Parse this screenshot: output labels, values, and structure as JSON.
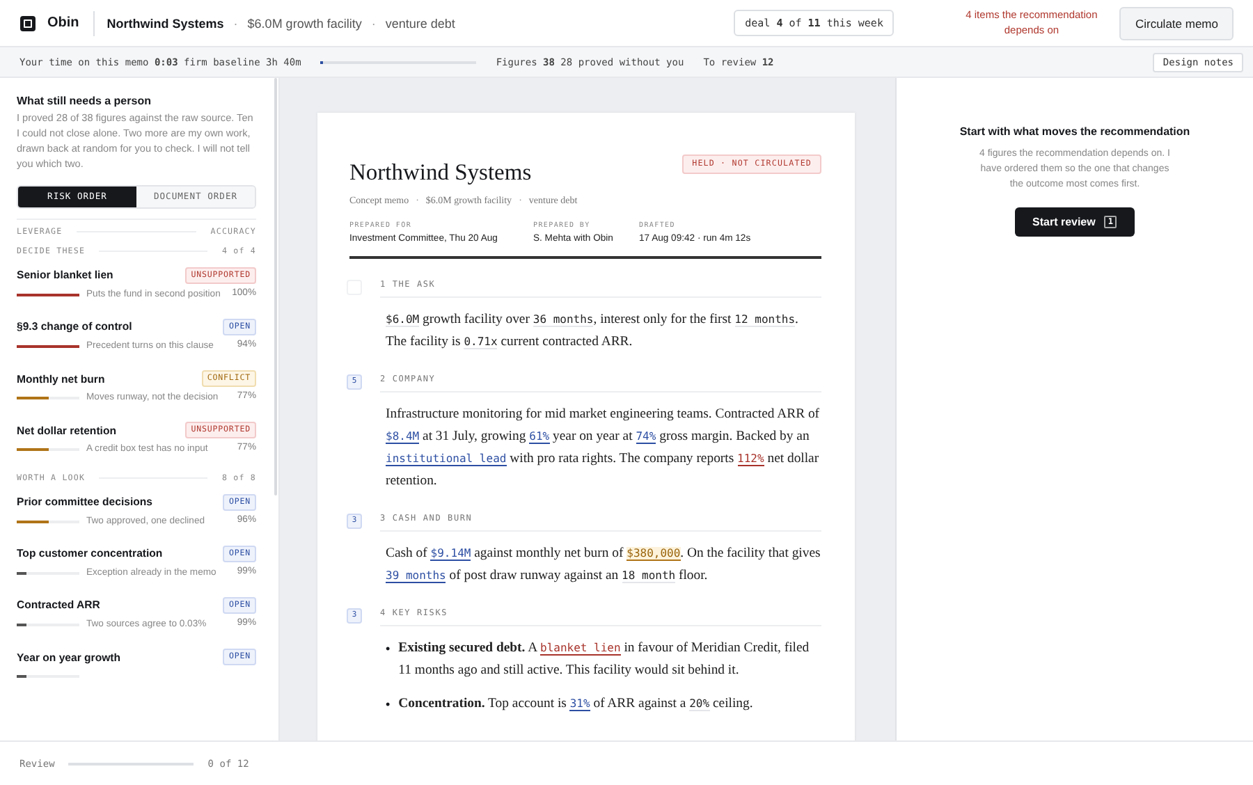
{
  "topbar": {
    "app_name": "Obin",
    "deal_name": "Northwind Systems",
    "separator": "·",
    "deal_facility": "$6.0M growth facility",
    "deal_type": "venture debt",
    "deal_counter": "deal **4** of **11** this week",
    "alert": "4 items the recommendation depends on",
    "action": "Circulate memo"
  },
  "statusbar": {
    "time_label": "Your time on this memo **0:03** firm baseline 3h 40m",
    "time_track": {
      "level": 0.01
    },
    "figures": "Figures **38** 28 proved without you",
    "to_review": "To review **12**",
    "design_notes": "Design notes"
  },
  "sidebar": {
    "title": "What still needs a person",
    "intro": "I proved 28 of 38 figures against the raw source. Ten I could not close alone. Two more are my own work, drawn back at random for you to check. I will not tell you which two.",
    "order_tabs": [
      {
        "label": "RISK ORDER",
        "selected": true
      },
      {
        "label": "DOCUMENT ORDER",
        "selected": false
      }
    ],
    "columns": {
      "left": "LEVERAGE",
      "right": "ACCURACY"
    },
    "groups": [
      {
        "title": "DECIDE THESE",
        "count": "4 of 4",
        "items": [
          {
            "title": "Senior blanket lien",
            "kind": "unsupported",
            "badge": "UNSUPPORTED",
            "note": "Puts the fund in second position",
            "accuracy": "100%",
            "level": 1.0
          },
          {
            "title": "§9.3 change of control",
            "kind": "open",
            "badge": "OPEN",
            "note": "Precedent turns on this clause",
            "accuracy": "94%",
            "level": 1.0
          },
          {
            "title": "Monthly net burn",
            "kind": "conflict",
            "badge": "CONFLICT",
            "note": "Moves runway, not the decision",
            "accuracy": "77%",
            "level": 0.5
          },
          {
            "title": "Net dollar retention",
            "kind": "unsupported",
            "badge": "UNSUPPORTED",
            "note": "A credit box test has no input",
            "accuracy": "77%",
            "level": 0.5
          }
        ]
      },
      {
        "title": "WORTH A LOOK",
        "count": "8 of 8",
        "items": [
          {
            "title": "Prior committee decisions",
            "kind": "open",
            "badge": "OPEN",
            "note": "Two approved, one declined",
            "accuracy": "96%",
            "level": 0.5
          },
          {
            "title": "Top customer concentration",
            "kind": "open",
            "badge": "OPEN",
            "note": "Exception already in the memo",
            "accuracy": "99%",
            "level": 0.15
          },
          {
            "title": "Contracted ARR",
            "kind": "open",
            "badge": "OPEN",
            "note": "Two sources agree to 0.03%",
            "accuracy": "99%",
            "level": 0.15
          },
          {
            "title": "Year on year growth",
            "kind": "open",
            "badge": "OPEN",
            "level": 0.15
          }
        ]
      }
    ],
    "review": {
      "label": "Review",
      "level": 0,
      "count": "0 of 12"
    }
  },
  "memo": {
    "title": "Northwind Systems",
    "stamp": "HELD · NOT CIRCULATED",
    "subtitle": [
      "Concept memo",
      "$6.0M growth facility",
      "venture debt"
    ],
    "separator": "·",
    "meta": [
      {
        "label": "PREPARED FOR",
        "value": "Investment Committee, Thu 20 Aug"
      },
      {
        "label": "PREPARED BY",
        "value": "S. Mehta with Obin"
      },
      {
        "label": "DRAFTED",
        "value": "17 Aug 09:42 · run 4m 12s"
      }
    ],
    "sections": [
      {
        "heading": "1 THE ASK",
        "kind": "paragraph",
        "blocks": [
          [
            {
              "kind": "proved",
              "text": "$6.0M"
            },
            {
              "kind": "plain",
              "text": " growth facility over "
            },
            {
              "kind": "proved",
              "text": "36 months"
            },
            {
              "kind": "plain",
              "text": ", interest only for the first "
            },
            {
              "kind": "proved",
              "text": "12 months"
            },
            {
              "kind": "plain",
              "text": ". The facility is "
            },
            {
              "kind": "proved",
              "text": "0.71x"
            },
            {
              "kind": "plain",
              "text": " current contracted ARR."
            }
          ]
        ]
      },
      {
        "heading": "2 COMPANY",
        "count": "5",
        "kind": "paragraph",
        "blocks": [
          [
            {
              "kind": "plain",
              "text": "Infrastructure monitoring for mid market engineering teams. Contracted ARR of "
            },
            {
              "kind": "open",
              "text": "$8.4M"
            },
            {
              "kind": "plain",
              "text": " at 31 July, growing "
            },
            {
              "kind": "open",
              "text": "61%"
            },
            {
              "kind": "plain",
              "text": " year on year at "
            },
            {
              "kind": "open",
              "text": "74%"
            },
            {
              "kind": "plain",
              "text": " gross margin. Backed by an "
            },
            {
              "kind": "open",
              "text": "institutional lead"
            },
            {
              "kind": "plain",
              "text": " with pro rata rights. The company reports "
            },
            {
              "kind": "unsupported",
              "text": "112%"
            },
            {
              "kind": "plain",
              "text": " net dollar retention."
            }
          ]
        ]
      },
      {
        "heading": "3 CASH AND BURN",
        "count": "3",
        "kind": "paragraph",
        "blocks": [
          [
            {
              "kind": "plain",
              "text": "Cash of "
            },
            {
              "kind": "open",
              "text": "$9.14M"
            },
            {
              "kind": "plain",
              "text": " against monthly net burn of "
            },
            {
              "kind": "conflict",
              "text": "$380,000"
            },
            {
              "kind": "plain",
              "text": ". On the facility that gives "
            },
            {
              "kind": "open",
              "text": "39 months"
            },
            {
              "kind": "plain",
              "text": " of post draw runway against an "
            },
            {
              "kind": "proved",
              "text": "18 month"
            },
            {
              "kind": "plain",
              "text": " floor."
            }
          ]
        ]
      },
      {
        "heading": "4 KEY RISKS",
        "count": "3",
        "kind": "bullets",
        "marker": "•",
        "blocks": [
          [
            {
              "kind": "plain",
              "text": "**Existing secured debt.** A "
            },
            {
              "kind": "unsupported",
              "text": "blanket lien"
            },
            {
              "kind": "plain",
              "text": " in favour of Meridian Credit, filed 11 months ago and still active. This facility would sit behind it."
            }
          ],
          [
            {
              "kind": "plain",
              "text": "**Concentration.** Top account is "
            },
            {
              "kind": "open",
              "text": "31%"
            },
            {
              "kind": "plain",
              "text": " of ARR against a "
            },
            {
              "kind": "proved",
              "text": "20%"
            },
            {
              "kind": "plain",
              "text": " ceiling."
            }
          ]
        ]
      }
    ]
  },
  "panel": {
    "title": "Start with what moves the recommendation",
    "body": "4 figures the recommendation depends on. I have ordered them so the one that changes the outcome most comes first.",
    "button": "Start review",
    "key": "1"
  }
}
